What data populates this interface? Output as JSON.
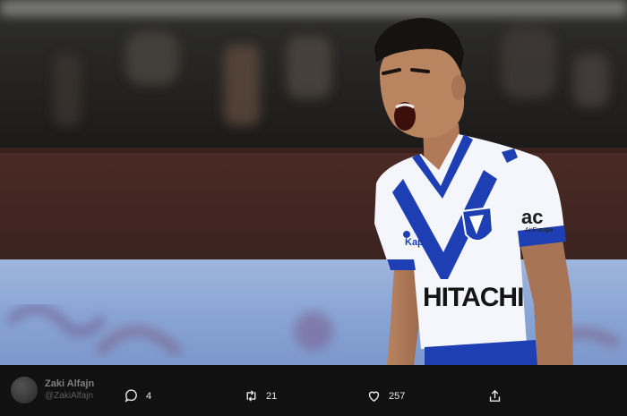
{
  "photo": {
    "description_icon": "player-celebration-photo",
    "shirt_sponsor": "HITACHI",
    "kit_brand": "Kappa",
    "sleeve_sponsor_logo": "ac",
    "sleeve_sponsor_text": "AirEuropa"
  },
  "tweet": {
    "author_name": "Zaki Alfajn",
    "author_handle": "@ZakiAlfajn",
    "reply_count": "4",
    "retweet_count": "21",
    "like_count": "257"
  },
  "colors": {
    "jersey_blue": "#1d3fb3",
    "jersey_white": "#f4f6fb",
    "action_bar": "#121212",
    "icon": "#e8e8e8"
  }
}
